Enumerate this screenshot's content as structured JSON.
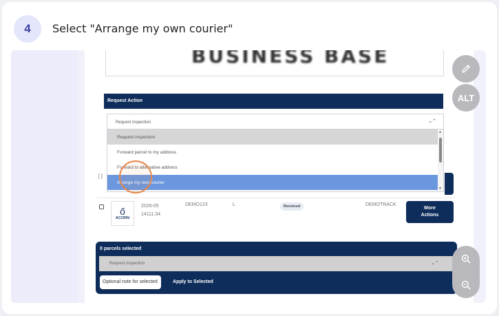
{
  "step": {
    "number": "4",
    "title": "Select \"Arrange my own courier\""
  },
  "logo": {
    "text": "BUSINESS BASE"
  },
  "request_action": {
    "header": "Request Action",
    "selected": "Request inspection",
    "chevron_icon": "chevron-updown-icon",
    "options": [
      {
        "label": "Request inspection"
      },
      {
        "label": "Forward parcel to my address"
      },
      {
        "label": "Forward to alternative address"
      },
      {
        "label": "Arrange my own courier"
      }
    ]
  },
  "row_marker": "[ ]",
  "parcel_row": {
    "brand": "ACORN",
    "date_line1": "2026-05",
    "date_line2": "14111:34",
    "reference": "DEMO123",
    "size": "L",
    "status": "Received",
    "tracking": "DEMOTRACK",
    "more_line1": "More",
    "more_line2": "Actions"
  },
  "bottom_bar": {
    "title": "0 parcels selected",
    "select_value": "Request inspection",
    "note_placeholder": "Optional note for selected",
    "apply_label": "Apply to Selected"
  },
  "tools": {
    "pencil_icon": "pencil-icon",
    "alt_label": "ALT",
    "zoom_in_icon": "zoom-in-icon",
    "zoom_out_icon": "zoom-out-icon"
  },
  "colors": {
    "navy": "#0e2d5a",
    "highlight": "#6b97df",
    "accent_ring": "#e8874a",
    "badge_bg": "#e4e6fb"
  }
}
